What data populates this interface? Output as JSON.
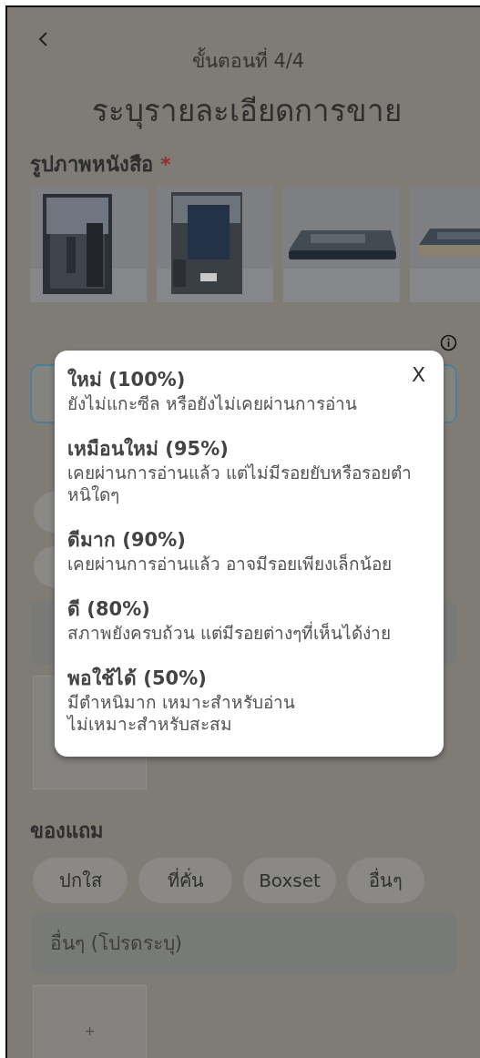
{
  "header": {
    "step": "ขั้นตอนที่ 4/4",
    "title": "ระบุรายละเอียดการขาย"
  },
  "photos_section": {
    "label": "รูปภาพหนังสือ",
    "required_mark": "*"
  },
  "condition_modal": {
    "close": "X",
    "options": [
      {
        "name": "ใหม่ (100%)",
        "description": "ยังไม่แกะซีล หรือยังไม่เคยผ่านการอ่าน"
      },
      {
        "name": "เหมือนใหม่ (95%)",
        "description": "เคยผ่านการอ่านแล้ว แต่ไม่มีรอยยับหรือรอยตำหนิใดๆ"
      },
      {
        "name": "ดีมาก (90%)",
        "description": "เคยผ่านการอ่านแล้ว อาจมีรอยเพียงเล็กน้อย"
      },
      {
        "name": "ดี (80%)",
        "description": "สภาพยังครบถ้วน แต่มีรอยต่างๆที่เห็นได้ง่าย"
      },
      {
        "name": "พอใช้ได้ (50%)",
        "description": "มีตำหนิมาก เหมาะสำหรับอ่าน\nไม่เหมาะสำหรับสะสม"
      }
    ]
  },
  "extras_section": {
    "label": "ของแถม",
    "chips": [
      {
        "label": "ปกใส",
        "selected": false
      },
      {
        "label": "ที่คั่น",
        "selected": false
      },
      {
        "label": "Boxset",
        "selected": false
      },
      {
        "label": "อื่นๆ",
        "selected": false
      }
    ],
    "other_field": {
      "placeholder": "อื่นๆ (โปรดระบุ)"
    },
    "upload": {
      "plus": "+"
    }
  }
}
